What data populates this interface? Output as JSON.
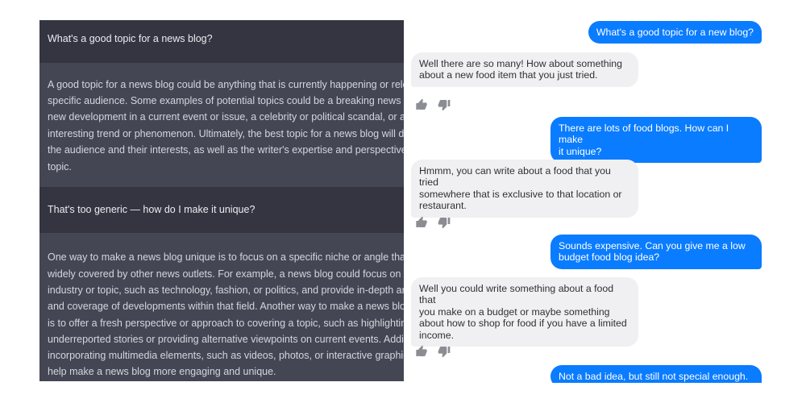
{
  "left_chat": {
    "turns": [
      {
        "role": "user",
        "lines": [
          "What's a good topic for a news blog?"
        ]
      },
      {
        "role": "assistant",
        "lines": [
          "A good topic for a news blog could be anything that is currently happening or relevant",
          "specific audience. Some examples of potential topics could be a breaking news event,",
          "new development in a current event or issue, a celebrity or political scandal, or an",
          "interesting trend or phenomenon. Ultimately, the best topic for a news blog will depen",
          "the audience and their interests, as well as the writer's expertise and perspective on t",
          "topic."
        ]
      },
      {
        "role": "user",
        "lines": [
          "That's too generic — how do I make it unique?"
        ]
      },
      {
        "role": "assistant",
        "lines": [
          "One way to make a news blog unique is to focus on a specific niche or angle that is no",
          "widely covered by other news outlets. For example, a news blog could focus on a spec",
          "industry or topic, such as technology, fashion, or politics, and provide in-depth analys",
          "and coverage of developments within that field. Another way to make a news blog uniq",
          "is to offer a fresh perspective or approach to covering a topic, such as highlighting",
          "underreported stories or providing alternative viewpoints on current events. Additiona",
          "incorporating multimedia elements, such as videos, photos, or interactive graphics, ca",
          "help make a news blog more engaging and unique."
        ]
      }
    ]
  },
  "right_chat": {
    "messages": [
      {
        "from": "me",
        "text": "What's a good topic for a new blog?"
      },
      {
        "from": "bot",
        "text": "Well there are so many! How about something\nabout a new food item that you just tried."
      },
      {
        "from": "me",
        "text": "There are lots of food blogs. How can I make\nit unique?"
      },
      {
        "from": "bot",
        "text": "Hmmm, you can write about a food that you tried\nsomewhere that is exclusive to that location or\nrestaurant."
      },
      {
        "from": "me",
        "text": "Sounds expensive. Can you give me a low\nbudget food blog idea?"
      },
      {
        "from": "bot",
        "text": "Well you could write something about a food that\nyou make on a budget or maybe something\nabout how to shop for food if you have a limited\nincome."
      },
      {
        "from": "me",
        "text": "Not a bad idea, but still not special enough."
      }
    ],
    "reaction_icons": [
      "thumbs-up-icon",
      "thumbs-down-icon"
    ]
  },
  "colors": {
    "user_turn_bg": "#343541",
    "assistant_turn_bg": "#444654",
    "my_bubble": "#0a7cff",
    "bot_bubble": "#f0f0f2"
  }
}
